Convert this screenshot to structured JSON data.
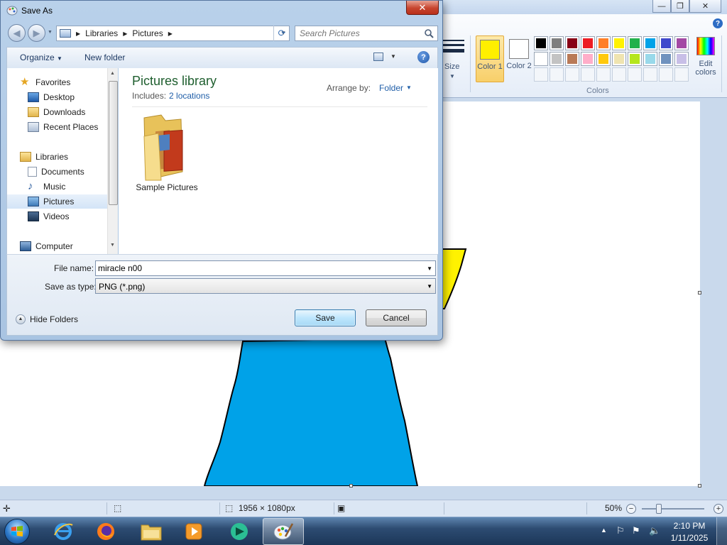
{
  "paint": {
    "window_controls": [
      "—",
      "❐",
      "✕"
    ],
    "help": "?",
    "size_label": "Size",
    "color1_label": "Color 1",
    "color2_label": "Color 2",
    "color1_value": "#ffef00",
    "color2_value": "#ffffff",
    "colors_group_label": "Colors",
    "edit_colors_label": "Edit colors",
    "palette_row1": [
      "#000000",
      "#7f7f7f",
      "#880015",
      "#ed1c24",
      "#ff7f27",
      "#fff200",
      "#22b14c",
      "#00a2e8",
      "#3f48cc",
      "#a349a4"
    ],
    "palette_row2": [
      "#ffffff",
      "#c3c3c3",
      "#b97a57",
      "#ffaec9",
      "#ffc90e",
      "#efe4b0",
      "#b5e61d",
      "#99d9ea",
      "#7092be",
      "#c8bfe7"
    ],
    "status": {
      "dimensions": "1956 × 1080px",
      "zoom": "50%"
    }
  },
  "dialog": {
    "title": "Save As",
    "close": "✕",
    "breadcrumb": [
      "Libraries",
      "Pictures"
    ],
    "search_placeholder": "Search Pictures",
    "toolbar": {
      "organize": "Organize",
      "new_folder": "New folder",
      "help": "?"
    },
    "nav": {
      "favorites": "Favorites",
      "desktop": "Desktop",
      "downloads": "Downloads",
      "recent_places": "Recent Places",
      "libraries": "Libraries",
      "documents": "Documents",
      "music": "Music",
      "pictures": "Pictures",
      "videos": "Videos",
      "computer": "Computer"
    },
    "content": {
      "title": "Pictures library",
      "includes_label": "Includes:",
      "includes_link": "2 locations",
      "arrange_label": "Arrange by:",
      "arrange_value": "Folder",
      "items": [
        "Sample Pictures"
      ]
    },
    "file_name_label": "File name:",
    "file_name_value": "miracle n00",
    "save_type_label": "Save as type:",
    "save_type_value": "PNG (*.png)",
    "hide_folders": "Hide Folders",
    "save_button": "Save",
    "cancel_button": "Cancel"
  },
  "taskbar": {
    "time": "2:10 PM",
    "date": "1/11/2025"
  }
}
